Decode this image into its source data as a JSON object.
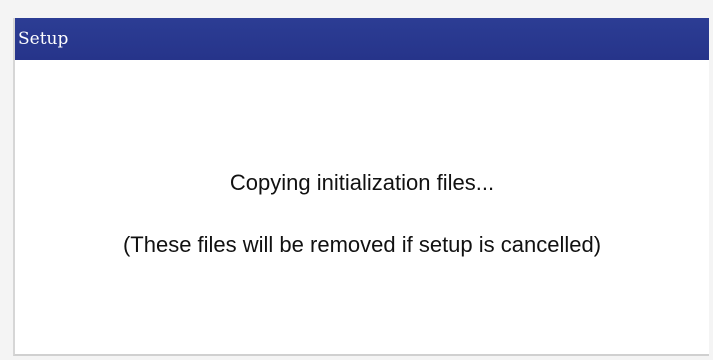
{
  "window": {
    "title": "Setup"
  },
  "content": {
    "status_message": "Copying initialization files...",
    "note_message": "(These files will be removed if setup is cancelled)"
  },
  "colors": {
    "title_bar": "#2a3a90",
    "background": "#ffffff",
    "text": "#111111"
  }
}
